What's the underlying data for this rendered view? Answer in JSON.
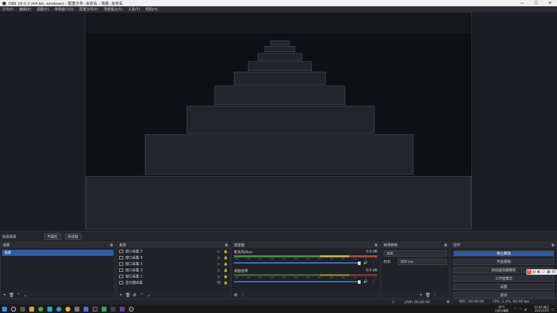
{
  "window": {
    "title": "OBS 28.0.3 (64-bit, windows) - 配置文件: 未命名 - 场景: 未命名",
    "min": "—",
    "max": "☐",
    "close": "✕"
  },
  "menu": [
    "文件(F)",
    "编辑(E)",
    "视图(V)",
    "停靠窗口(D)",
    "配置文件(P)",
    "场景集合(S)",
    "工具(T)",
    "帮助(H)"
  ],
  "dockbar": {
    "label": "未选择源",
    "props": "属性",
    "filters": "滤镜"
  },
  "scenes": {
    "title": "场景",
    "items": [
      "场景"
    ]
  },
  "sources": {
    "title": "来源",
    "items": [
      "窗口采集 5",
      "窗口采集 4",
      "窗口采集 3",
      "窗口采集 2",
      "窗口采集 1",
      "显示器采集"
    ]
  },
  "mixer": {
    "title": "混音器",
    "channels": [
      {
        "name": "麦克风/Aux",
        "db": "0.0 dB"
      },
      {
        "name": "桌面音频",
        "db": "0.0 dB"
      }
    ],
    "ticks": [
      "-60",
      "-55",
      "-50",
      "-45",
      "-40",
      "-35",
      "-30",
      "-25",
      "-20",
      "-15",
      "-10",
      "-5",
      "0"
    ]
  },
  "transitions": {
    "title": "转场特效",
    "type": "淡出",
    "duration_label": "时长",
    "duration": "300 ms"
  },
  "controls": {
    "title": "控件",
    "buttons": [
      "停止推流",
      "开始录制",
      "启动虚拟摄像机",
      "工作室模式",
      "设置",
      "退出"
    ]
  },
  "status": {
    "live": "LIVE: 00:00:00",
    "rec": "REC: 00:00:00",
    "cpu": "CPU: 1.2%, 60.00 fps"
  },
  "taskbar": {
    "weather": "26°C",
    "weather_sub": "大部分晴朗",
    "time": "23:44 周日",
    "date": "2025/1/23"
  },
  "colors": {
    "accent": "#2d5ba7",
    "bg": "#1b1d22",
    "panel": "#1f2227"
  }
}
